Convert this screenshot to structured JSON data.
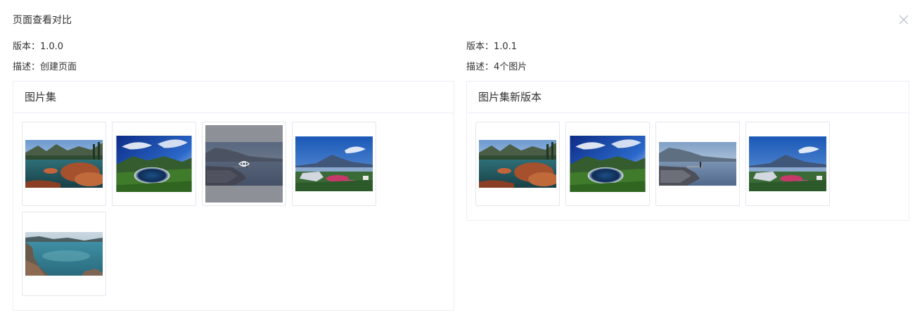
{
  "dialog": {
    "title": "页面查看对比"
  },
  "left": {
    "version_text": "版本：1.0.0",
    "description_text": "描述：创建页面",
    "card_title": "图片集",
    "images": [
      {
        "icon": "lake-rocks-image"
      },
      {
        "icon": "crater-lake-image"
      },
      {
        "icon": "pier-lake-image",
        "hovered": true,
        "preview_icon": "eye-icon"
      },
      {
        "icon": "mountain-bay-image"
      },
      {
        "icon": "coast-rocks-image"
      }
    ]
  },
  "right": {
    "version_text": "版本：1.0.1",
    "description_text": "描述：4个图片",
    "card_title": "图片集新版本",
    "images": [
      {
        "icon": "lake-rocks-image"
      },
      {
        "icon": "crater-lake-image"
      },
      {
        "icon": "pier-lake-image"
      },
      {
        "icon": "mountain-bay-image"
      }
    ]
  },
  "colors": {
    "border": "#ebeef5",
    "text": "#303133",
    "close_icon": "#c0c4cc",
    "hover_overlay": "#3c3f4e"
  }
}
